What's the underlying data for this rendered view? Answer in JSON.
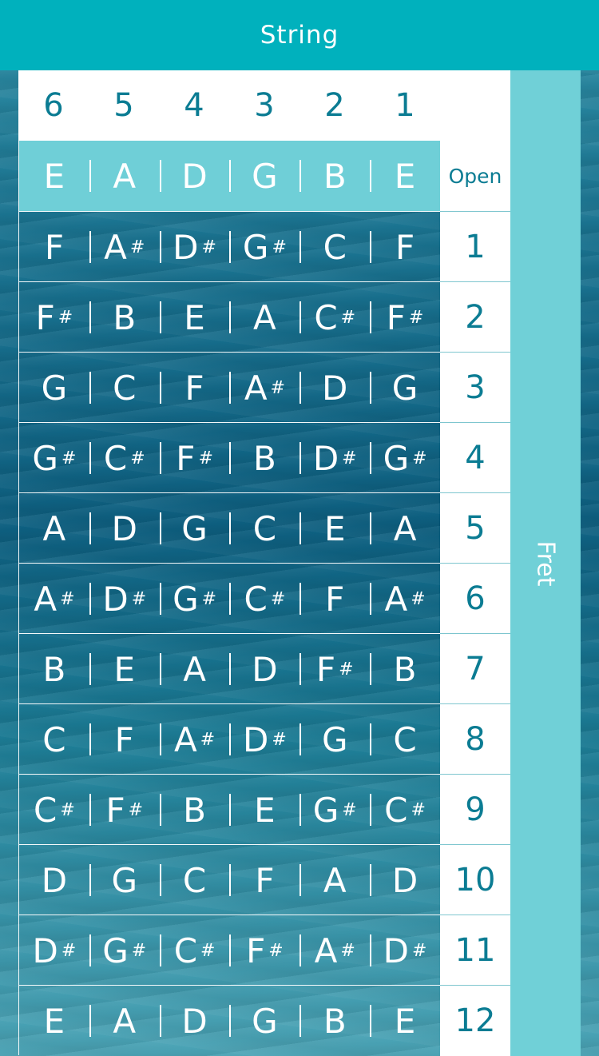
{
  "title": "String",
  "fret_title": "Fret",
  "strings": [
    "6",
    "5",
    "4",
    "3",
    "2",
    "1"
  ],
  "rows": [
    {
      "fret": "Open",
      "notes": [
        "E",
        "A",
        "D",
        "G",
        "B",
        "E"
      ]
    },
    {
      "fret": "1",
      "notes": [
        "F",
        "A#",
        "D#",
        "G#",
        "C",
        "F"
      ]
    },
    {
      "fret": "2",
      "notes": [
        "F#",
        "B",
        "E",
        "A",
        "C#",
        "F#"
      ]
    },
    {
      "fret": "3",
      "notes": [
        "G",
        "C",
        "F",
        "A#",
        "D",
        "G"
      ]
    },
    {
      "fret": "4",
      "notes": [
        "G#",
        "C#",
        "F#",
        "B",
        "D#",
        "G#"
      ]
    },
    {
      "fret": "5",
      "notes": [
        "A",
        "D",
        "G",
        "C",
        "E",
        "A"
      ]
    },
    {
      "fret": "6",
      "notes": [
        "A#",
        "D#",
        "G#",
        "C#",
        "F",
        "A#"
      ]
    },
    {
      "fret": "7",
      "notes": [
        "B",
        "E",
        "A",
        "D",
        "F#",
        "B"
      ]
    },
    {
      "fret": "8",
      "notes": [
        "C",
        "F",
        "A#",
        "D#",
        "G",
        "C"
      ]
    },
    {
      "fret": "9",
      "notes": [
        "C#",
        "F#",
        "B",
        "E",
        "G#",
        "C#"
      ]
    },
    {
      "fret": "10",
      "notes": [
        "D",
        "G",
        "C",
        "F",
        "A",
        "D"
      ]
    },
    {
      "fret": "11",
      "notes": [
        "D#",
        "G#",
        "C#",
        "F#",
        "A#",
        "D#"
      ]
    },
    {
      "fret": "12",
      "notes": [
        "E",
        "A",
        "D",
        "G",
        "B",
        "E"
      ]
    }
  ],
  "colors": {
    "accent": "#00b1bd",
    "fret_strip": "#70d0d7",
    "number_text": "#0b7c93",
    "open_row": "#6fcfd7"
  }
}
